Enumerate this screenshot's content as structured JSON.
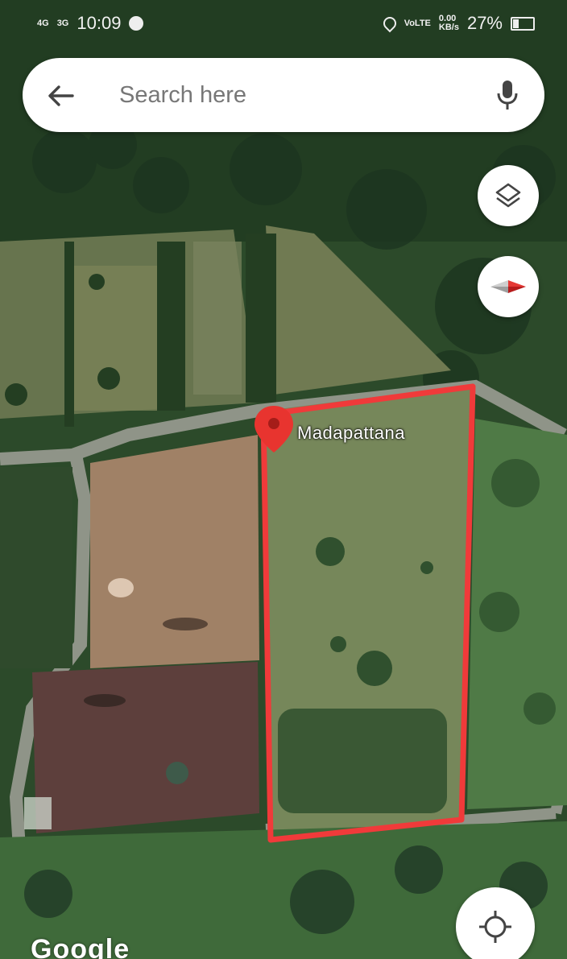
{
  "status_bar": {
    "network_1": "4G",
    "network_2": "3G",
    "time": "10:09",
    "data_speed": "0.00",
    "data_unit": "KB/s",
    "battery": "27%"
  },
  "search": {
    "placeholder": "Search here"
  },
  "map": {
    "place_label": "Madapattana",
    "attribution": "Google",
    "boundary_color": "#f03a3a",
    "pin_color": "#e8342f"
  },
  "controls": {
    "layers_icon": "layers-icon",
    "compass_icon": "compass-icon",
    "location_icon": "my-location-icon",
    "mic_icon": "mic-icon",
    "back_icon": "back-arrow-icon"
  }
}
